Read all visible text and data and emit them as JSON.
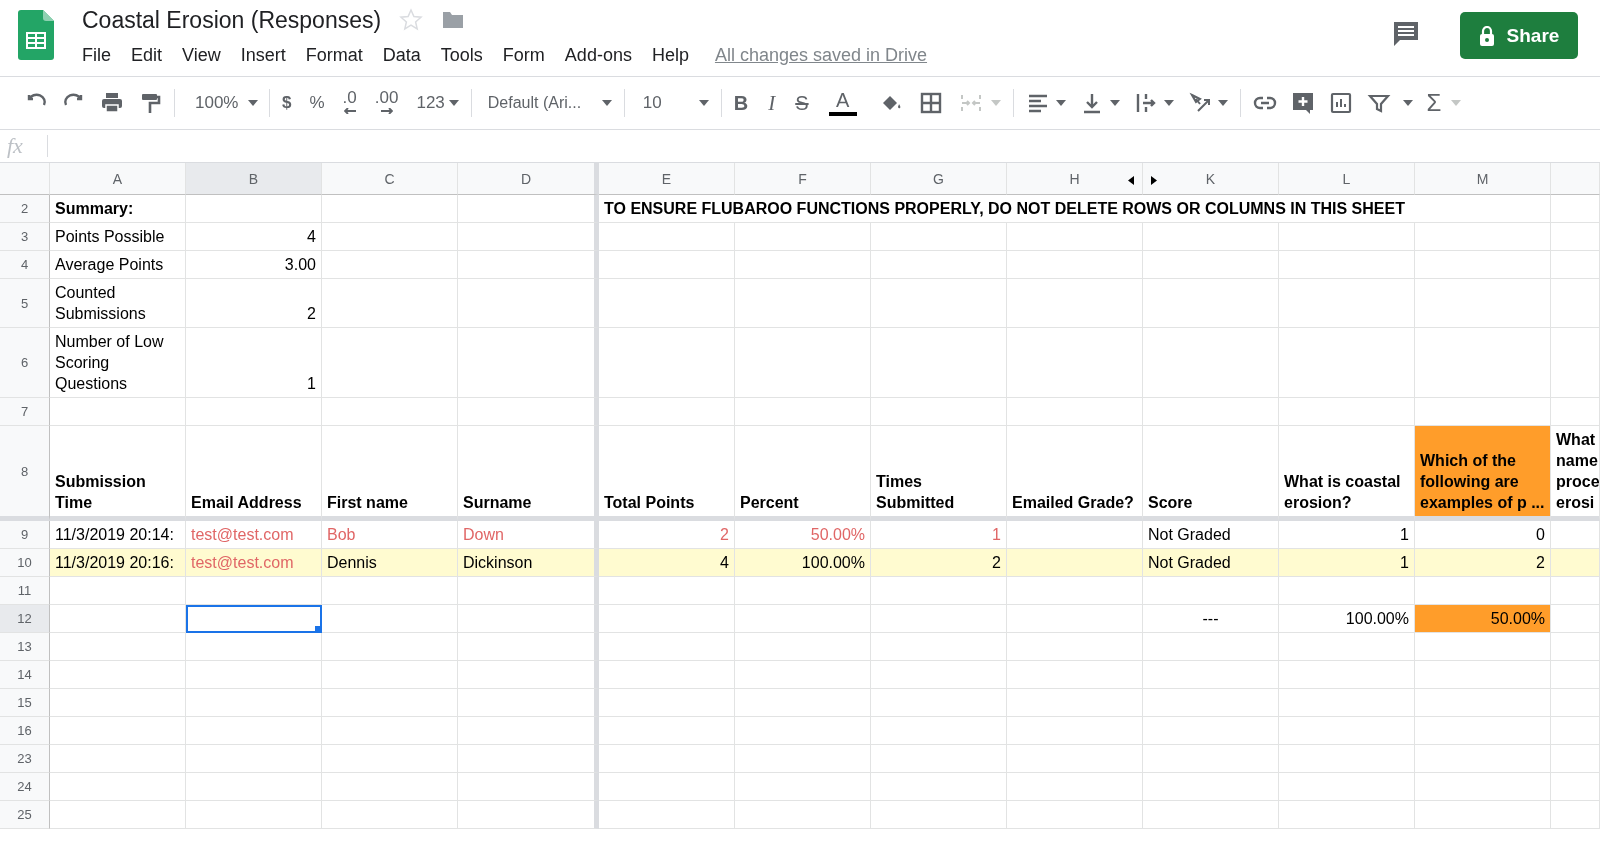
{
  "document": {
    "title": "Coastal Erosion (Responses)",
    "save_status": "All changes saved in Drive"
  },
  "menu": [
    "File",
    "Edit",
    "View",
    "Insert",
    "Format",
    "Data",
    "Tools",
    "Form",
    "Add-ons",
    "Help"
  ],
  "share_button": "Share",
  "toolbar": {
    "zoom": "100%",
    "currency": "$",
    "percent": "%",
    "decrease_decimal": ".0",
    "increase_decimal": ".00",
    "more_formats": "123",
    "font": "Default (Ari...",
    "font_size": "10",
    "bold": "B",
    "italic": "I",
    "strikethrough": "S",
    "text_color": "A",
    "functions": "Σ"
  },
  "formula_bar": {
    "label": "fx"
  },
  "sheet": {
    "columns": [
      {
        "label": "A",
        "selected": false,
        "freeze_edge": false,
        "hidden_after": false
      },
      {
        "label": "B",
        "selected": true,
        "freeze_edge": false,
        "hidden_after": false
      },
      {
        "label": "C",
        "selected": false,
        "freeze_edge": false,
        "hidden_after": false
      },
      {
        "label": "D",
        "selected": false,
        "freeze_edge": true,
        "hidden_after": false
      },
      {
        "label": "E",
        "selected": false,
        "freeze_edge": false,
        "hidden_after": false
      },
      {
        "label": "F",
        "selected": false,
        "freeze_edge": false,
        "hidden_after": false
      },
      {
        "label": "G",
        "selected": false,
        "freeze_edge": false,
        "hidden_after": false
      },
      {
        "label": "H",
        "selected": false,
        "freeze_edge": false,
        "hidden_after": true
      },
      {
        "label": "K",
        "selected": false,
        "freeze_edge": false,
        "hidden_after": false
      },
      {
        "label": "L",
        "selected": false,
        "freeze_edge": false,
        "hidden_after": false
      },
      {
        "label": "M",
        "selected": false,
        "freeze_edge": false,
        "hidden_after": false
      },
      {
        "selected": false,
        "freeze_edge": false,
        "hidden_after": false
      }
    ],
    "rows": [
      {
        "number": "2",
        "selected": false,
        "freeze_edge": false,
        "highlighted": false,
        "cells": [
          {
            "text": "Summary:",
            "kind": "text",
            "bold": true
          },
          {},
          {},
          {},
          {
            "text": "TO ENSURE FLUBAROO FUNCTIONS PROPERLY, DO NOT DELETE ROWS OR COLUMNS IN THIS SHEET",
            "kind": "text",
            "bold": true,
            "overflow": true
          }
        ]
      },
      {
        "number": "3",
        "selected": false,
        "freeze_edge": false,
        "highlighted": false,
        "cells": [
          {
            "text": "Points Possible",
            "kind": "text"
          },
          {
            "text": "4",
            "kind": "number"
          }
        ]
      },
      {
        "number": "4",
        "selected": false,
        "freeze_edge": false,
        "highlighted": false,
        "cells": [
          {
            "text": "Average Points",
            "kind": "text"
          },
          {
            "text": "3.00",
            "kind": "number"
          }
        ]
      },
      {
        "number": "5",
        "selected": false,
        "freeze_edge": false,
        "highlighted": false,
        "cells": [
          {
            "text": "Counted Submissions",
            "kind": "text"
          },
          {
            "text": "2",
            "kind": "number"
          }
        ]
      },
      {
        "number": "6",
        "selected": false,
        "freeze_edge": false,
        "highlighted": false,
        "cells": [
          {
            "text": "Number of Low Scoring Questions",
            "kind": "text"
          },
          {
            "text": "1",
            "kind": "number"
          }
        ]
      },
      {
        "number": "7",
        "selected": false,
        "freeze_edge": false,
        "highlighted": false,
        "cells": []
      },
      {
        "number": "8",
        "selected": false,
        "freeze_edge": true,
        "highlighted": false,
        "cells": [
          {
            "text": "Submission Time",
            "kind": "text",
            "bold": true
          },
          {
            "text": "Email Address",
            "kind": "text",
            "bold": true
          },
          {
            "text": "First name",
            "kind": "text",
            "bold": true
          },
          {
            "text": "Surname",
            "kind": "text",
            "bold": true
          },
          {
            "text": "Total Points",
            "kind": "text",
            "bold": true
          },
          {
            "text": "Percent",
            "kind": "text",
            "bold": true
          },
          {
            "text": "Times Submitted",
            "kind": "text",
            "bold": true
          },
          {
            "text": "Emailed Grade?",
            "kind": "text",
            "bold": true
          },
          {
            "text": "Score",
            "kind": "text",
            "bold": true
          },
          {
            "text": "What is coastal erosion?",
            "kind": "text",
            "bold": true
          },
          {
            "text": "Which of the following are examples of p ...",
            "kind": "text",
            "bold": true,
            "flagged": true
          },
          {
            "text": "What name proce erosi",
            "kind": "text",
            "bold": true
          }
        ]
      },
      {
        "number": "9",
        "selected": false,
        "freeze_edge": false,
        "highlighted": false,
        "cells": [
          {
            "text": "11/3/2019 20:14:",
            "kind": "text"
          },
          {
            "text": "test@test.com",
            "kind": "text",
            "color": "#e06666"
          },
          {
            "text": "Bob",
            "kind": "text",
            "color": "#e06666"
          },
          {
            "text": "Down",
            "kind": "text",
            "color": "#e06666"
          },
          {
            "text": "2",
            "kind": "number",
            "color": "#e06666"
          },
          {
            "text": "50.00%",
            "kind": "number",
            "color": "#e06666"
          },
          {
            "text": "1",
            "kind": "number",
            "color": "#e06666"
          },
          {},
          {
            "text": "Not Graded",
            "kind": "text"
          },
          {
            "text": "1",
            "kind": "number"
          },
          {
            "text": "0",
            "kind": "number"
          }
        ]
      },
      {
        "number": "10",
        "selected": false,
        "freeze_edge": false,
        "highlighted": true,
        "cells": [
          {
            "text": "11/3/2019 20:16:",
            "kind": "text"
          },
          {
            "text": "test@test.com",
            "kind": "text",
            "color": "#e06666"
          },
          {
            "text": "Dennis",
            "kind": "text"
          },
          {
            "text": "Dickinson",
            "kind": "text"
          },
          {
            "text": "4",
            "kind": "number"
          },
          {
            "text": "100.00%",
            "kind": "number"
          },
          {
            "text": "2",
            "kind": "number"
          },
          {},
          {
            "text": "Not Graded",
            "kind": "text"
          },
          {
            "text": "1",
            "kind": "number"
          },
          {
            "text": "2",
            "kind": "number"
          }
        ]
      },
      {
        "number": "11",
        "selected": false,
        "freeze_edge": false,
        "highlighted": false,
        "cells": []
      },
      {
        "number": "12",
        "selected": true,
        "freeze_edge": false,
        "highlighted": false,
        "cells": [
          {},
          {},
          {},
          {},
          {},
          {},
          {},
          {},
          {
            "text": "---",
            "kind": "centered"
          },
          {
            "text": "100.00%",
            "kind": "number"
          },
          {
            "text": "50.00%",
            "kind": "number",
            "flagged": true
          }
        ]
      },
      {
        "number": "13",
        "selected": false,
        "freeze_edge": false,
        "highlighted": false,
        "cells": []
      },
      {
        "number": "14",
        "selected": false,
        "freeze_edge": false,
        "highlighted": false,
        "cells": []
      },
      {
        "number": "15",
        "selected": false,
        "freeze_edge": false,
        "highlighted": false,
        "cells": []
      },
      {
        "number": "16",
        "selected": false,
        "freeze_edge": false,
        "highlighted": false,
        "cells": []
      },
      {
        "number": "23",
        "selected": false,
        "freeze_edge": false,
        "highlighted": false,
        "cells": []
      },
      {
        "number": "24",
        "selected": false,
        "freeze_edge": false,
        "highlighted": false,
        "cells": []
      },
      {
        "number": "25",
        "selected": false,
        "freeze_edge": false,
        "highlighted": false,
        "cells": []
      }
    ]
  }
}
